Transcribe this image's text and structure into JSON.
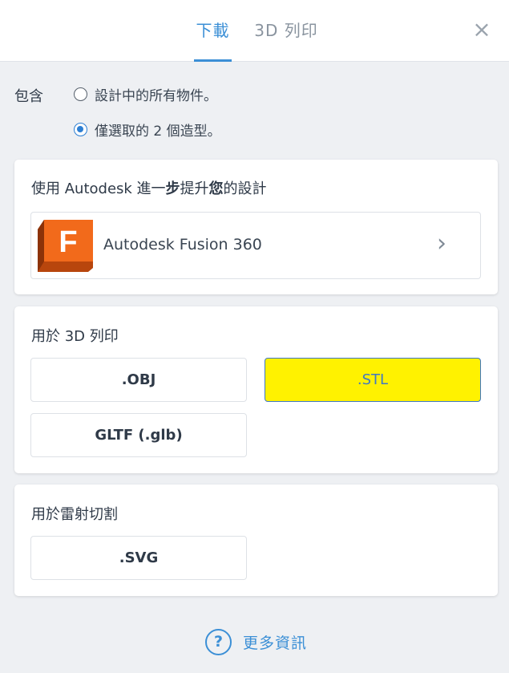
{
  "tabs": [
    {
      "label": "下載",
      "active": true
    },
    {
      "label": "3D 列印",
      "active": false
    }
  ],
  "close_icon": "close-icon",
  "include": {
    "label": "包含",
    "options": [
      {
        "label": "設計中的所有物件。",
        "checked": false
      },
      {
        "label": "僅選取的 2 個造型。",
        "checked": true
      }
    ]
  },
  "fusion_card": {
    "title_pre": "使用 Autodesk 進一",
    "title_b1": "步",
    "title_mid": "提升",
    "title_b2": "您",
    "title_post": "的設計",
    "product": {
      "name": "Autodesk Fusion 360",
      "logo_letter": "F",
      "icon": "chevron-right-icon"
    }
  },
  "print_card": {
    "title": "用於 3D 列印",
    "formats": [
      {
        "label": ".OBJ",
        "selected": false
      },
      {
        "label": ".STL",
        "selected": true
      },
      {
        "label": "GLTF (.glb)",
        "selected": false
      }
    ]
  },
  "laser_card": {
    "title": "用於雷射切割",
    "formats": [
      {
        "label": ".SVG",
        "selected": false
      }
    ]
  },
  "more_info": {
    "label": "更多資訊",
    "icon": "help-icon",
    "icon_glyph": "?"
  },
  "colors": {
    "accent": "#3b8fd6",
    "selected_bg": "#fff200",
    "logo_orange": "#f26a1b",
    "logo_dark": "#b8460d"
  }
}
